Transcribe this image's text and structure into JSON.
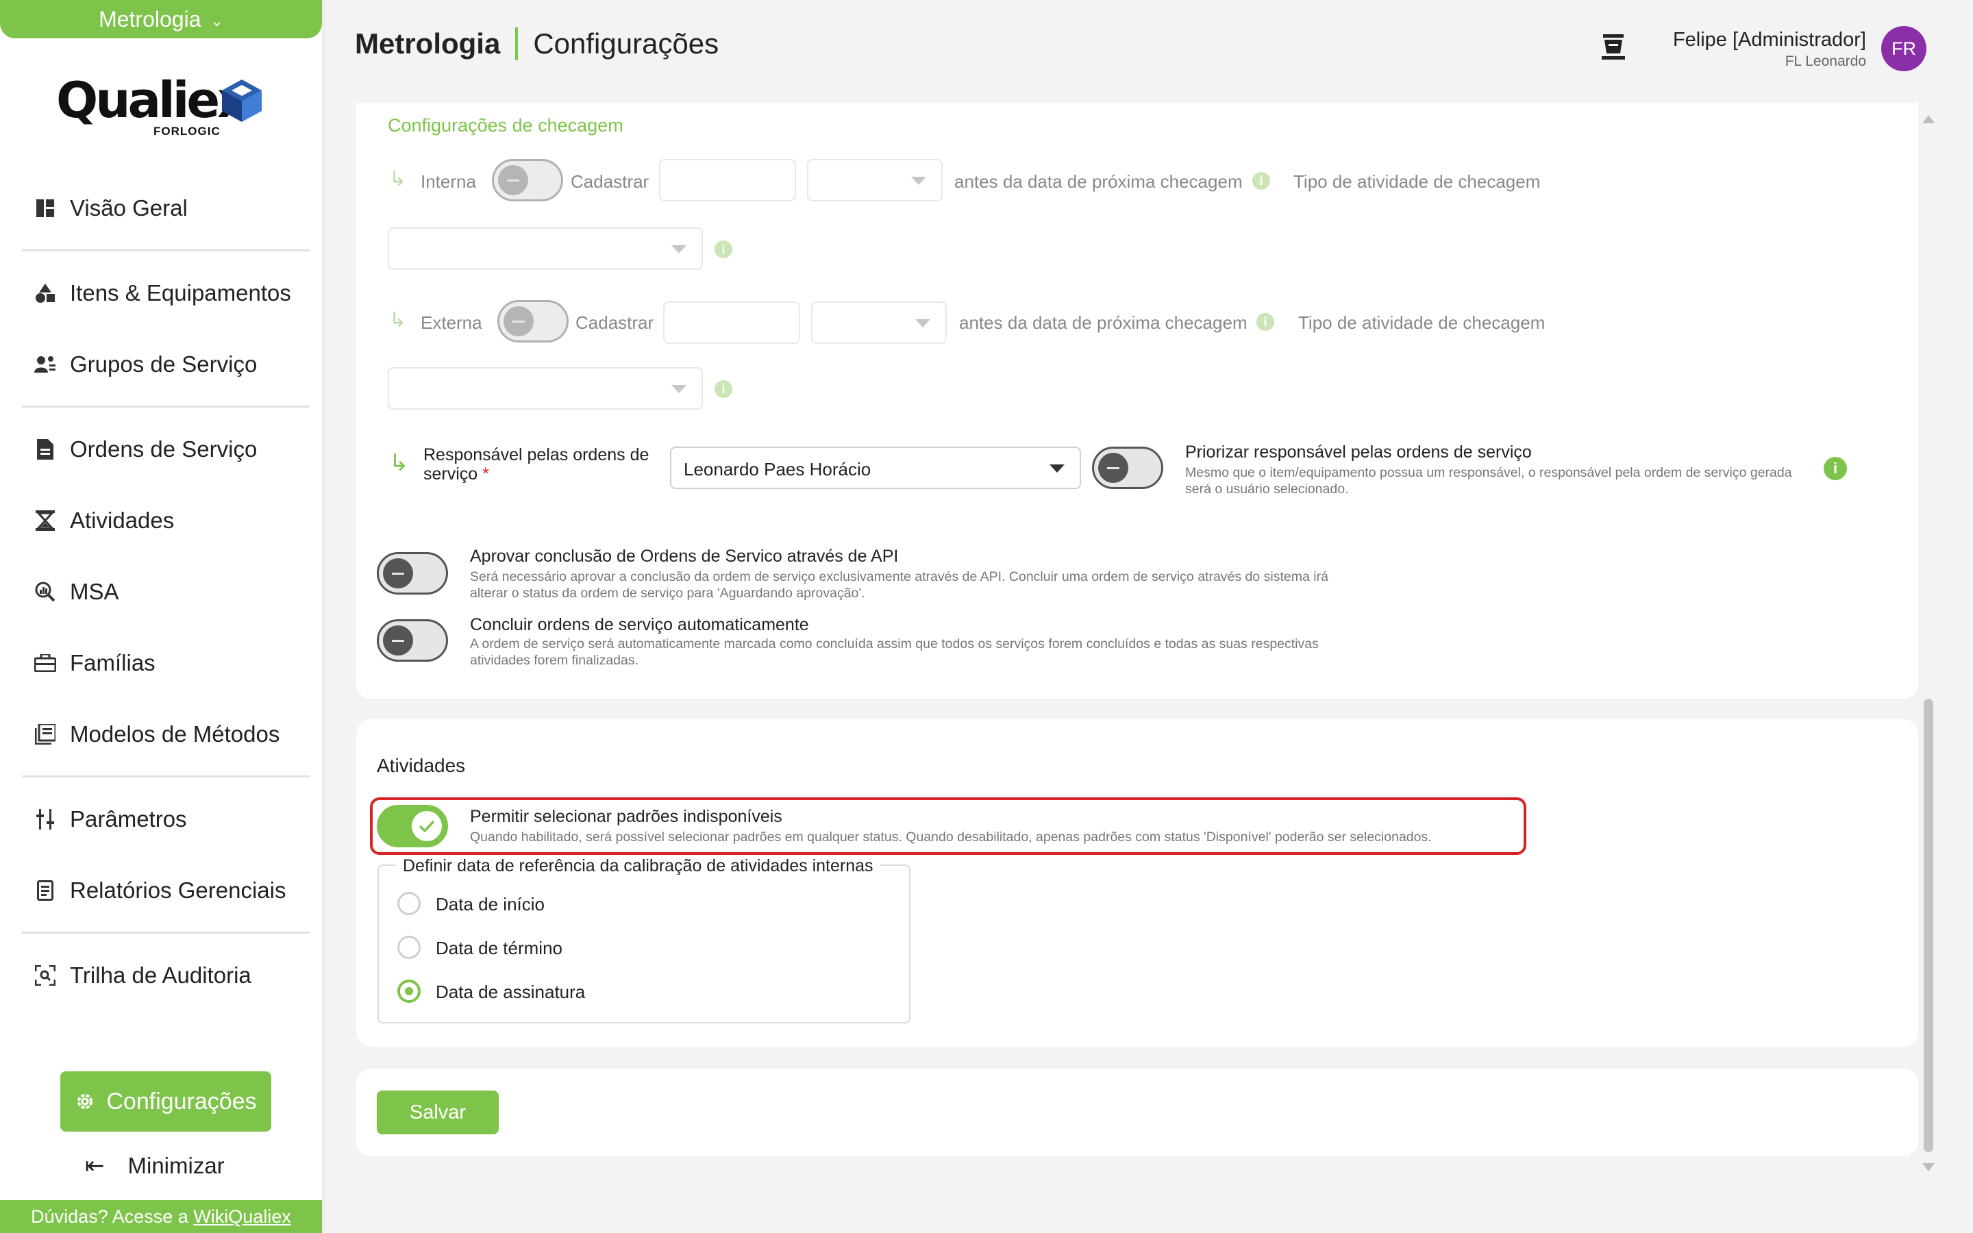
{
  "sidebar": {
    "module_switcher": "Metrologia",
    "logo_text": "Qualiex",
    "logo_sub": "FORLOGIC",
    "items": [
      {
        "label": "Visão Geral",
        "icon": "dashboard-icon"
      },
      {
        "label": "Itens & Equipamentos",
        "icon": "shapes-icon"
      },
      {
        "label": "Grupos de Serviço",
        "icon": "user-group-icon"
      },
      {
        "label": "Ordens de Serviço",
        "icon": "document-icon"
      },
      {
        "label": "Atividades",
        "icon": "hourglass-icon"
      },
      {
        "label": "MSA",
        "icon": "magnify-chart-icon"
      },
      {
        "label": "Famílias",
        "icon": "toolbox-icon"
      },
      {
        "label": "Modelos de Métodos",
        "icon": "library-icon"
      },
      {
        "label": "Parâmetros",
        "icon": "sliders-icon"
      },
      {
        "label": "Relatórios Gerenciais",
        "icon": "report-icon"
      },
      {
        "label": "Trilha de Auditoria",
        "icon": "audit-scan-icon"
      }
    ],
    "config_button": "Configurações",
    "minimize": "Minimizar",
    "help_prefix": "Dúvidas? Acesse a",
    "help_link": "WikiQualiex"
  },
  "header": {
    "module": "Metrologia",
    "page": "Configurações",
    "user_name": "Felipe [Administrador]",
    "user_org": "FL Leonardo",
    "avatar_initials": "FR"
  },
  "checagem": {
    "section_title": "Configurações de checagem",
    "internal": {
      "label": "Interna",
      "register_label": "Cadastrar",
      "before_text": "antes da data de próxima checagem",
      "activity_type_label": "Tipo de atividade de checagem",
      "days_value": "",
      "unit_value": "",
      "activity_type_value": ""
    },
    "external": {
      "label": "Externa",
      "register_label": "Cadastrar",
      "before_text": "antes da data de próxima checagem",
      "activity_type_label": "Tipo de atividade de checagem",
      "days_value": "",
      "unit_value": "",
      "activity_type_value": ""
    },
    "responsible": {
      "label": "Responsável pelas ordens de serviço",
      "required_mark": "*",
      "value": "Leonardo Paes Horácio",
      "prioritize_title": "Priorizar responsável pelas ordens de serviço",
      "prioritize_desc": "Mesmo que o item/equipamento possua um responsável, o responsável pela ordem de serviço gerada será o usuário selecionado."
    },
    "api_approval": {
      "title": "Aprovar conclusão de Ordens de Servico através de API",
      "desc": "Será necessário aprovar a conclusão da ordem de serviço exclusivamente através de API. Concluir uma ordem de serviço através do sistema irá alterar o status da ordem de serviço para 'Aguardando aprovação'.",
      "enabled": false
    },
    "auto_complete": {
      "title": "Concluir ordens de serviço automaticamente",
      "desc": "A ordem de serviço será automaticamente marcada como concluída assim que todos os serviços forem concluídos e todas as suas respectivas atividades forem finalizadas.",
      "enabled": false
    }
  },
  "atividades": {
    "section_title": "Atividades",
    "allow_unavailable": {
      "title": "Permitir selecionar padrões indisponíveis",
      "desc": "Quando habilitado, será possível selecionar padrões em qualquer status. Quando desabilitado, apenas padrões com status 'Disponível' poderão ser selecionados.",
      "enabled": true
    },
    "reference_date": {
      "legend": "Definir data de referência da calibração de atividades internas",
      "options": [
        "Data de início",
        "Data de término",
        "Data de assinatura"
      ],
      "selected": "Data de assinatura"
    }
  },
  "save_button": "Salvar",
  "colors": {
    "accent": "#7ec44a",
    "highlight": "#d62424",
    "avatar": "#8b2fa8"
  }
}
